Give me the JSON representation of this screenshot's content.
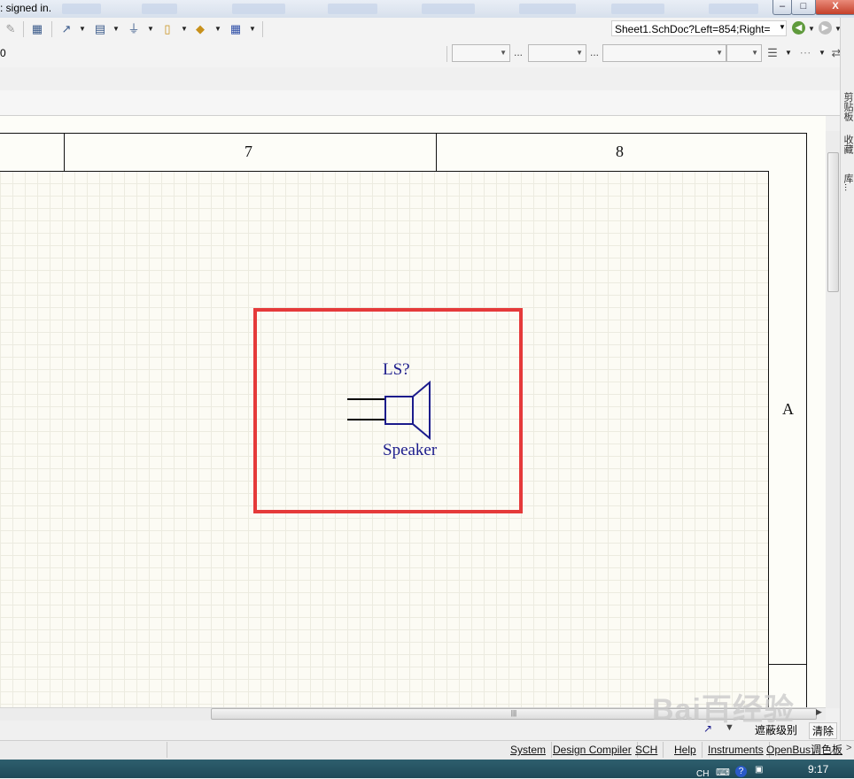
{
  "titlebar": {
    "signed_text": ": signed in.",
    "minimize": "–",
    "maximize": "□",
    "close": "X"
  },
  "toolbar": {
    "left_value": "0",
    "document_path": "Sheet1.SchDoc?Left=854;Right=",
    "ellipsis": "..."
  },
  "sheet": {
    "zone_columns": [
      "7",
      "8"
    ],
    "zone_row": "A"
  },
  "component": {
    "designator": "LS?",
    "comment": "Speaker",
    "wire_color": "#000000",
    "symbol_color": "#1c1c8c",
    "highlight_color": "#e53a3a"
  },
  "right_panel_tabs": [
    "剪贴板",
    "收藏",
    "库..."
  ],
  "bottom_strip": {
    "mask_level": "遮蔽级别",
    "clear": "清除"
  },
  "statusbar": {
    "buttons": [
      "System",
      "Design Compiler",
      "SCH",
      "Help",
      "Instruments",
      "OpenBus调色板"
    ]
  },
  "taskbar": {
    "lang": "CH",
    "time": "9:17"
  },
  "watermark": "Bai百经验"
}
